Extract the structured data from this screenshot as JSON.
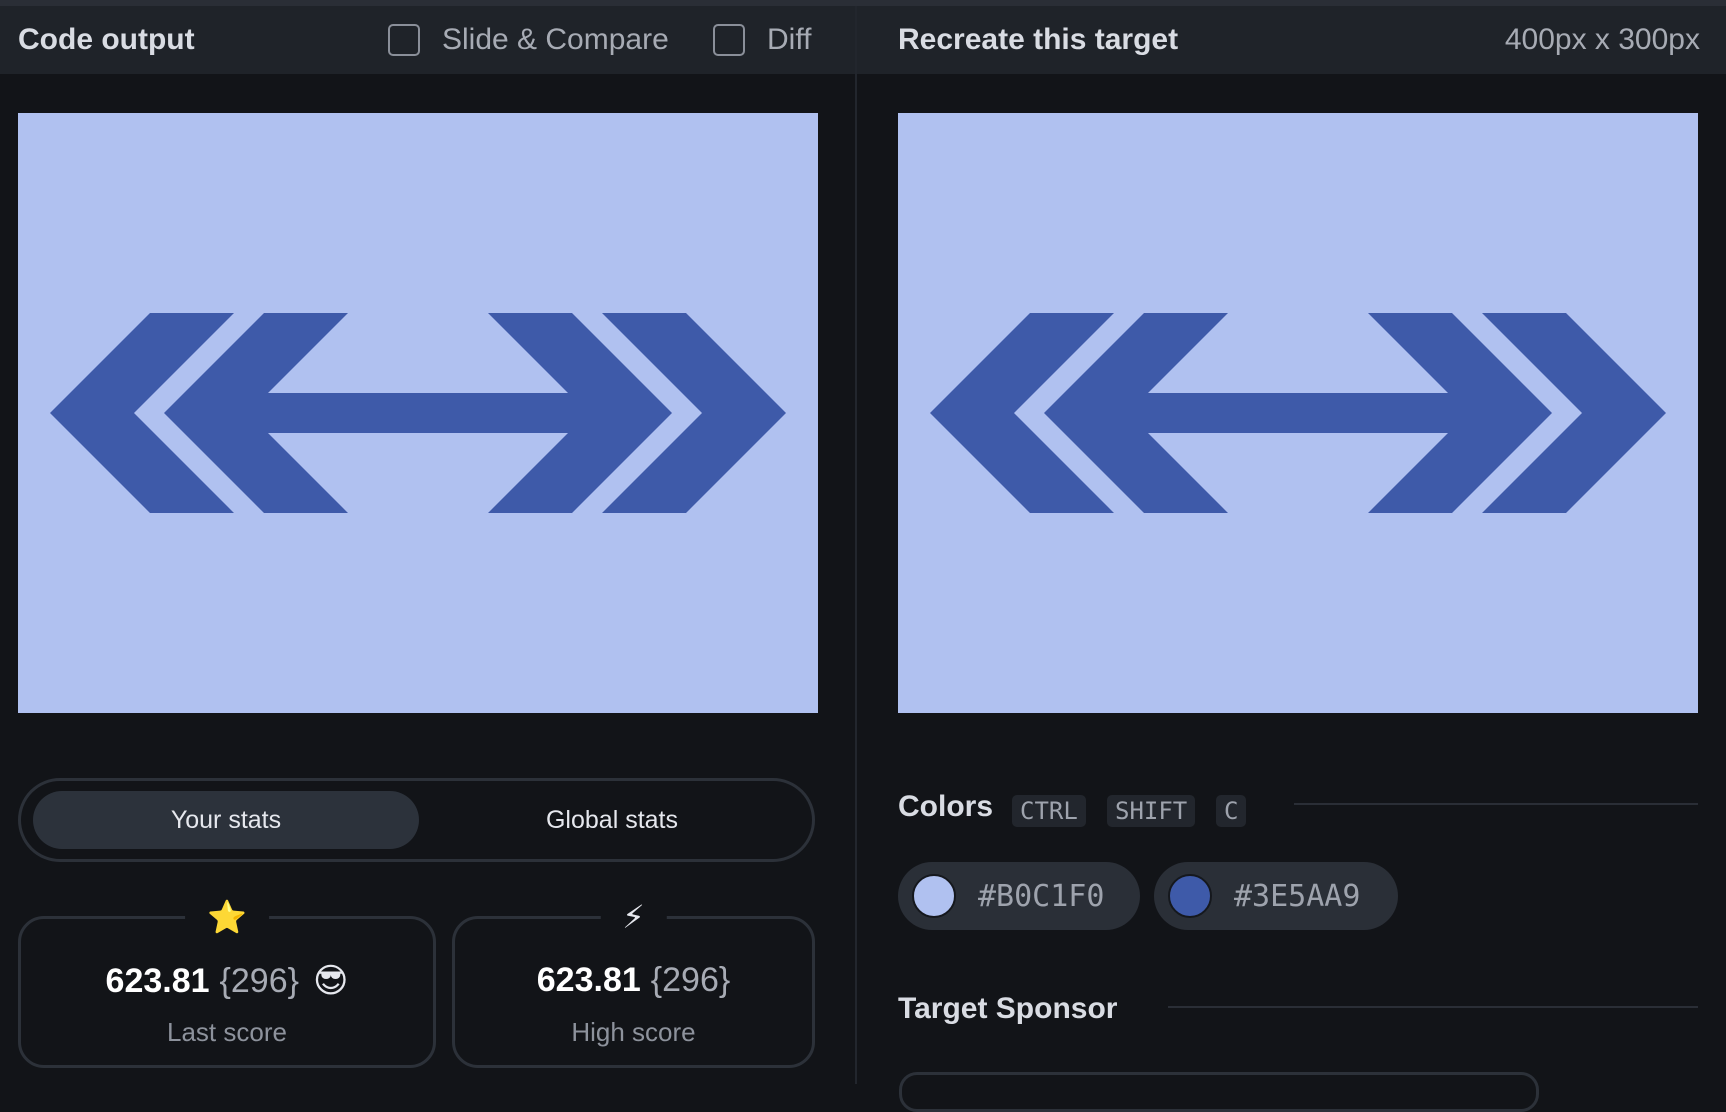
{
  "colors": {
    "background": "#B0C1F0",
    "foreground": "#3E5AA9"
  },
  "left_panel": {
    "title": "Code output",
    "options": [
      {
        "label": "Slide & Compare",
        "checked": false
      },
      {
        "label": "Diff",
        "checked": false
      }
    ]
  },
  "right_panel": {
    "title": "Recreate this target",
    "size_label": "400px x 300px"
  },
  "stats": {
    "tabs": [
      "Your stats",
      "Global stats"
    ],
    "active_tab": "Your stats",
    "last": {
      "icon": "star-icon",
      "glyph": "⭐",
      "score": "623.81",
      "count": "{296}",
      "emoji": "😎",
      "label": "Last score"
    },
    "high": {
      "icon": "lightning-icon",
      "glyph": "⚡",
      "score": "623.81",
      "count": "{296}",
      "label": "High score"
    }
  },
  "colors_section": {
    "title": "Colors",
    "shortcut": [
      "CTRL",
      "SHIFT",
      "C"
    ],
    "swatches": [
      {
        "hex": "#B0C1F0",
        "color": "#B0C1F0"
      },
      {
        "hex": "#3E5AA9",
        "color": "#3E5AA9"
      }
    ]
  },
  "sponsor": {
    "title": "Target Sponsor"
  }
}
